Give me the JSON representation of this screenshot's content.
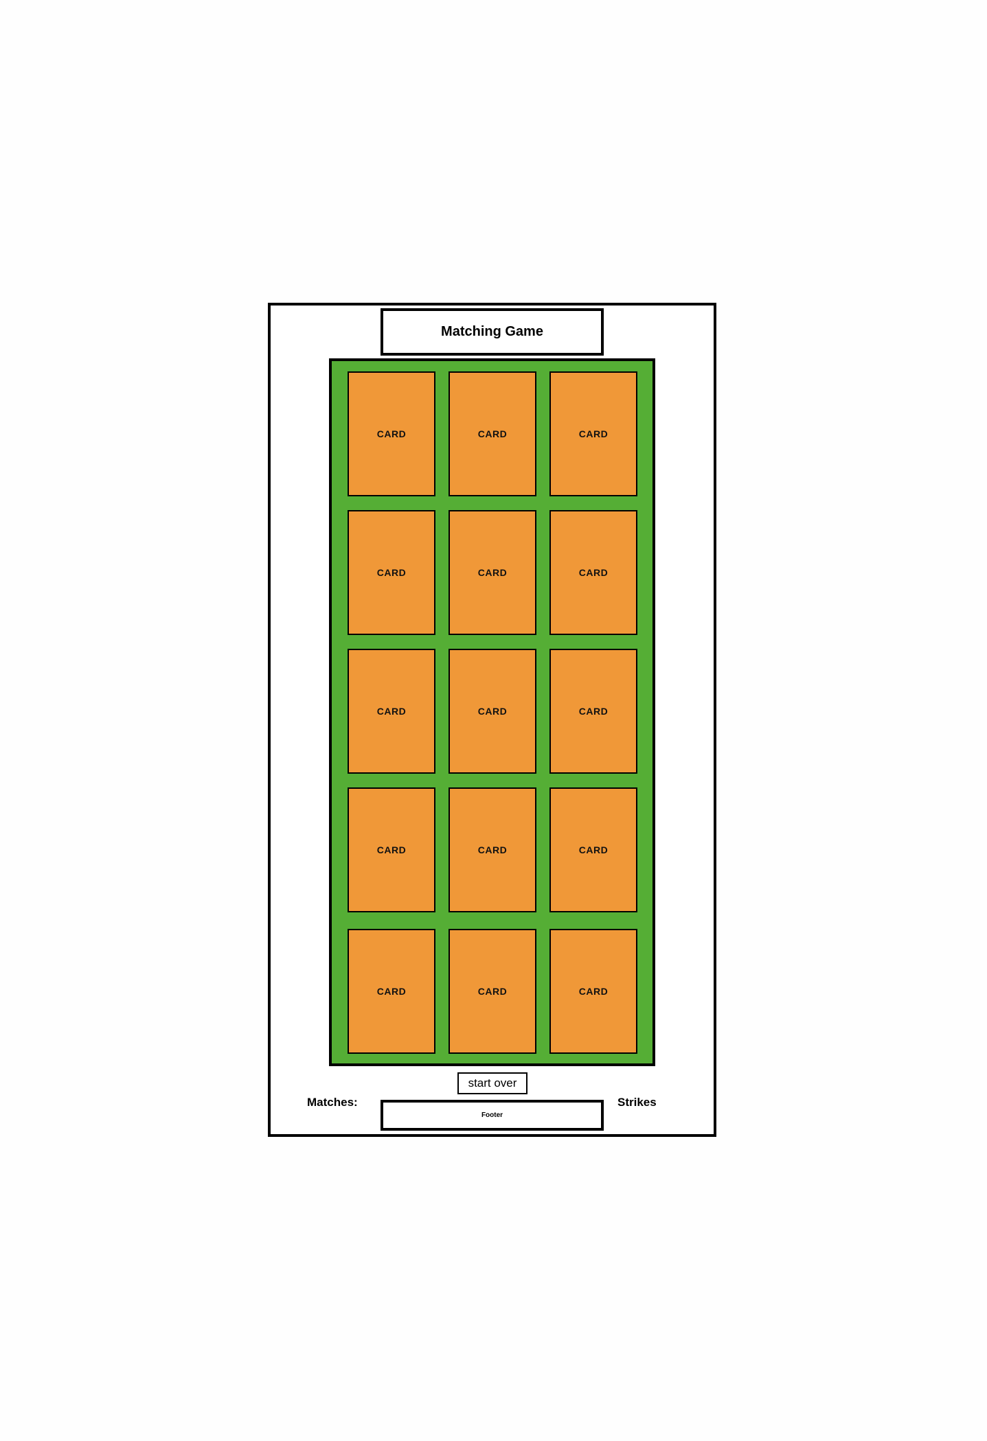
{
  "header": {
    "title": "Matching Game"
  },
  "board": {
    "columns": 3,
    "rows": 5,
    "colors": {
      "board": "#55AE35",
      "card": "#F09838"
    },
    "cards": [
      {
        "label": "CARD"
      },
      {
        "label": "CARD"
      },
      {
        "label": "CARD"
      },
      {
        "label": "CARD"
      },
      {
        "label": "CARD"
      },
      {
        "label": "CARD"
      },
      {
        "label": "CARD"
      },
      {
        "label": "CARD"
      },
      {
        "label": "CARD"
      },
      {
        "label": "CARD"
      },
      {
        "label": "CARD"
      },
      {
        "label": "CARD"
      },
      {
        "label": "CARD"
      },
      {
        "label": "CARD"
      },
      {
        "label": "CARD"
      }
    ]
  },
  "controls": {
    "start_over_label": "start over"
  },
  "status": {
    "matches_label": "Matches:",
    "strikes_label": "Strikes"
  },
  "footer": {
    "label": "Footer"
  }
}
